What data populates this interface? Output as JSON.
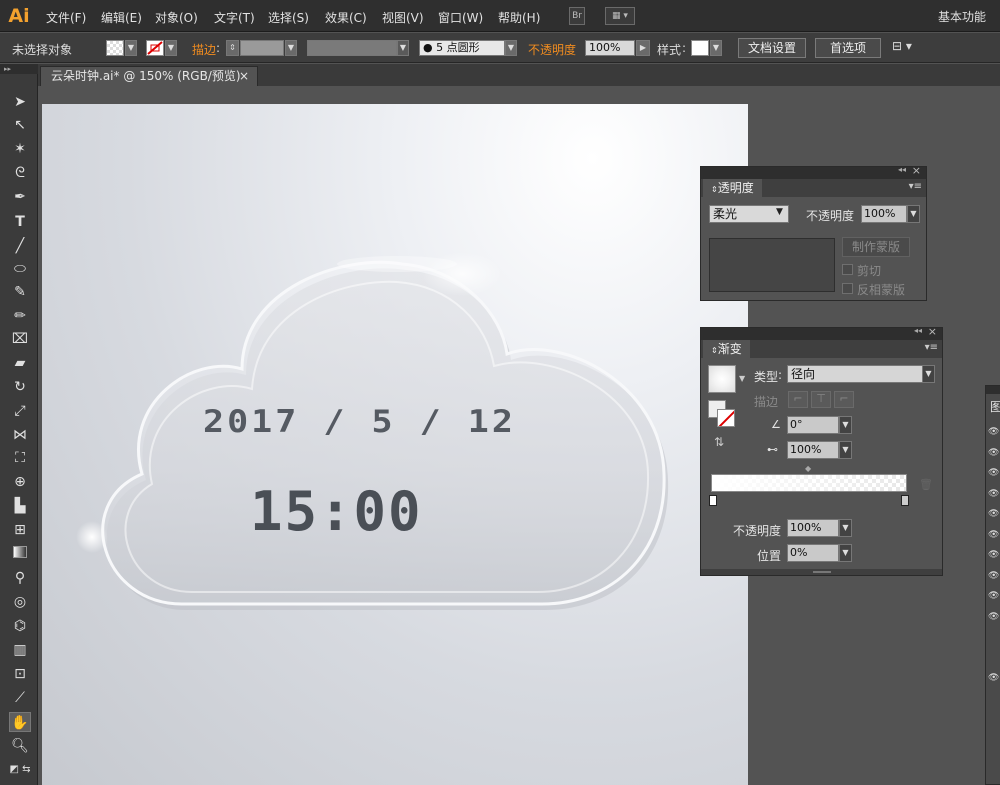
{
  "app": {
    "logo": "Ai",
    "workspace": "基本功能"
  },
  "menu": [
    "文件(F)",
    "编辑(E)",
    "对象(O)",
    "文字(T)",
    "选择(S)",
    "效果(C)",
    "视图(V)",
    "窗口(W)",
    "帮助(H)"
  ],
  "menubar_icons": {
    "bridge": "Br"
  },
  "control": {
    "selection_status": "未选择对象",
    "stroke_label": "描边",
    "brush": "5 点圆形",
    "opacity_label": "不透明度",
    "opacity_value": "100%",
    "style_label": "样式",
    "doc_setup": "文档设置",
    "preferences": "首选项"
  },
  "document": {
    "tab_title": "云朵时钟.ai* @ 150% (RGB/预览)",
    "close": "×"
  },
  "artwork": {
    "date": "2017 / 5 / 12",
    "time": "15:00"
  },
  "transparency_panel": {
    "title": "透明度",
    "blend_mode": "柔光",
    "opacity_label": "不透明度",
    "opacity_value": "100%",
    "make_mask": "制作蒙版",
    "clip": "剪切",
    "invert_mask": "反相蒙版"
  },
  "gradient_panel": {
    "title": "渐变",
    "type_label": "类型",
    "type_value": "径向",
    "stroke_label": "描边",
    "angle_value": "0°",
    "aspect_value": "100%",
    "opacity_label": "不透明度",
    "opacity_value": "100%",
    "location_label": "位置",
    "location_value": "0%"
  },
  "layers_panel": {
    "title_fragment": "图"
  },
  "colors": {
    "accent": "#f08c20",
    "logo": "#f3a12e",
    "chrome": "#535353"
  }
}
